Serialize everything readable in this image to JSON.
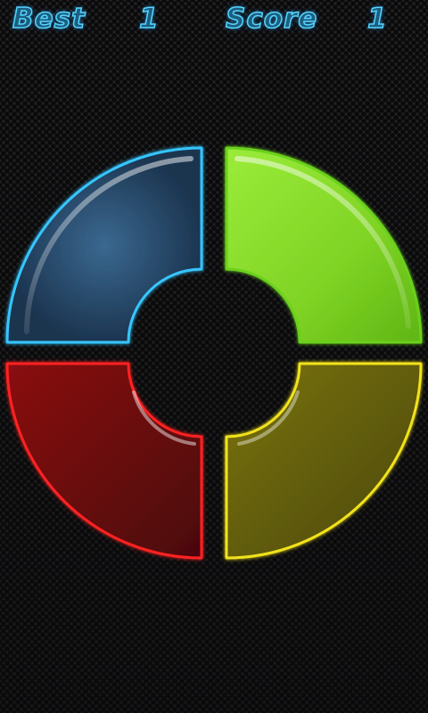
{
  "hud": {
    "best_label": "Best",
    "best_value": "1",
    "score_label": "Score",
    "score_value": "1"
  },
  "pads": {
    "blue": {
      "fill": "#2a4866",
      "stroke": "#36c6ff"
    },
    "green": {
      "fill": "#86d92a",
      "stroke": "#6ad11e"
    },
    "red": {
      "fill": "#6a0a0c",
      "stroke": "#ff2222"
    },
    "yellow": {
      "fill": "#5f5a0a",
      "stroke": "#f2e21c"
    }
  },
  "colors": {
    "background": "#1b1b1d",
    "hud_text": "#56d4ff"
  }
}
